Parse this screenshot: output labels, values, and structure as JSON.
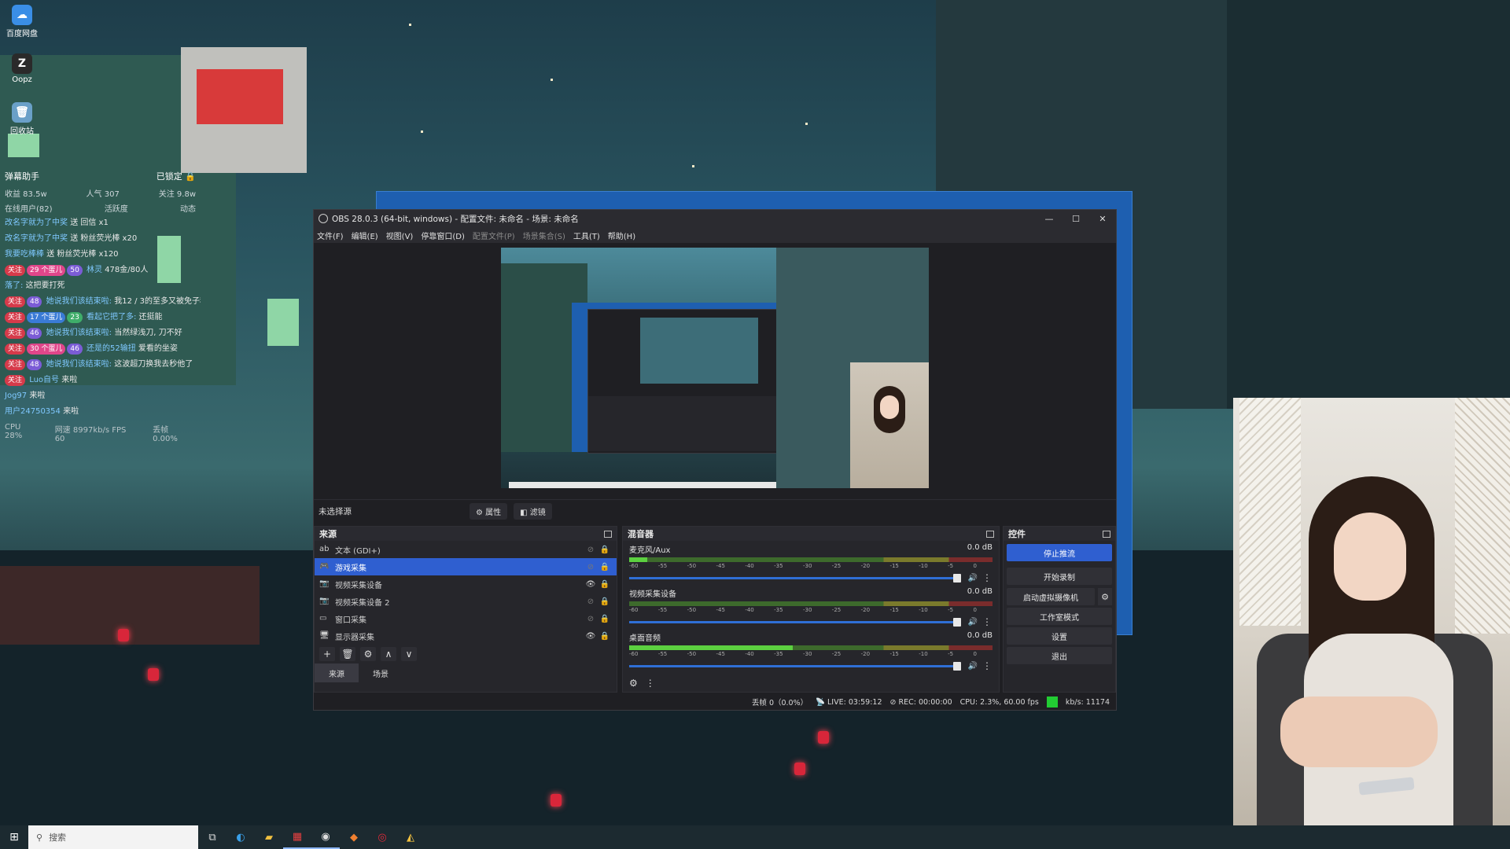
{
  "desktop": {
    "icons": [
      {
        "label": "百度网盘",
        "icon": "baidu-netdisk-icon",
        "color": "#3a8ee6"
      },
      {
        "label": "Oopz",
        "icon": "oopz-icon",
        "color": "#2a2a2a"
      },
      {
        "label": "回收站",
        "icon": "recycle-bin-icon",
        "color": "#6aa0c8"
      }
    ]
  },
  "danmaku": {
    "title": "弹幕助手",
    "locked": "已锁定",
    "stats": [
      "收益 83.5w",
      "人气 307",
      "关注 9.8w"
    ],
    "stats2": [
      "在线用户(82)",
      "活跃度",
      "动态"
    ],
    "messages": [
      {
        "badges": [],
        "user": "改名字就为了中奖",
        "text": "送 回信 x1"
      },
      {
        "badges": [],
        "user": "改名字就为了中奖",
        "text": "送 粉丝荧光棒 x20"
      },
      {
        "badges": [],
        "user": "我要吃棒棒",
        "text": "送 粉丝荧光棒 x120"
      },
      {
        "badges": [
          "关注",
          "29 个蛋儿",
          "50"
        ],
        "user": "林灵",
        "text": "478金/80人"
      },
      {
        "badges": [],
        "user": "落了:",
        "text": "这把要打死"
      },
      {
        "badges": [
          "关注",
          "48"
        ],
        "user": "她说我们该结束啦:",
        "text": "我12 / 3的至多又被免子秒了"
      },
      {
        "badges": [
          "关注",
          "17 个蛋儿",
          "23"
        ],
        "user": "看起它把了多:",
        "text": "还挺能"
      },
      {
        "badges": [
          "关注",
          "46"
        ],
        "user": "她说我们该结束啦:",
        "text": "当然绿浅刀, 刀不好"
      },
      {
        "badges": [
          "关注",
          "30 个蛋儿",
          "46"
        ],
        "user": "还是的52输扭",
        "text": "爱看的坐姿"
      },
      {
        "badges": [
          "关注",
          "48"
        ],
        "user": "她说我们该结束啦:",
        "text": "这波超刀换我去秒他了"
      },
      {
        "badges": [
          "关注"
        ],
        "user": "Luo自号",
        "text": "来啦"
      },
      {
        "badges": [],
        "user": "Jog97",
        "text": "来啦"
      },
      {
        "badges": [],
        "user": "用户24750354",
        "text": "来啦"
      }
    ],
    "footer": [
      "CPU 28%",
      "网速 8997kb/s FPS 60",
      "丢帧 0.00%"
    ]
  },
  "obs": {
    "title": "OBS 28.0.3 (64-bit, windows) - 配置文件: 未命名 - 场景: 未命名",
    "menu": [
      {
        "label": "文件(F)",
        "disabled": false
      },
      {
        "label": "编辑(E)",
        "disabled": false
      },
      {
        "label": "视图(V)",
        "disabled": false
      },
      {
        "label": "停靠窗口(D)",
        "disabled": false
      },
      {
        "label": "配置文件(P)",
        "disabled": true
      },
      {
        "label": "场景集合(S)",
        "disabled": true
      },
      {
        "label": "工具(T)",
        "disabled": false
      },
      {
        "label": "帮助(H)",
        "disabled": false
      }
    ],
    "scene_bar": {
      "label": "未选择源",
      "properties": "属性",
      "filters": "滤镜"
    },
    "sources": {
      "title": "来源",
      "items": [
        {
          "name": "文本 (GDI+)",
          "icon": "text-icon",
          "visible": false,
          "selected": false
        },
        {
          "name": "游戏采集",
          "icon": "gamepad-icon",
          "visible": false,
          "selected": true
        },
        {
          "name": "视频采集设备",
          "icon": "camera-icon",
          "visible": true,
          "selected": false
        },
        {
          "name": "视频采集设备 2",
          "icon": "camera-icon",
          "visible": false,
          "selected": false
        },
        {
          "name": "窗口采集",
          "icon": "window-icon",
          "visible": false,
          "selected": false
        },
        {
          "name": "显示器采集",
          "icon": "monitor-icon",
          "visible": true,
          "selected": false
        }
      ],
      "tabs": [
        "来源",
        "场景"
      ]
    },
    "mixer": {
      "title": "混音器",
      "ticks": [
        "-60",
        "-55",
        "-50",
        "-45",
        "-40",
        "-35",
        "-30",
        "-25",
        "-20",
        "-15",
        "-10",
        "-5",
        "0"
      ],
      "channels": [
        {
          "name": "麦克风/Aux",
          "db": "0.0 dB",
          "level": 0.05
        },
        {
          "name": "视频采集设备",
          "db": "0.0 dB",
          "level": 0.0
        },
        {
          "name": "桌面音频",
          "db": "0.0 dB",
          "level": 0.45
        }
      ]
    },
    "controls": {
      "title": "控件",
      "buttons": [
        "停止推流",
        "开始录制",
        "启动虚拟摄像机",
        "工作室模式",
        "设置",
        "退出"
      ]
    },
    "status": {
      "dropped": "丢帧 0（0.0%）",
      "live": "LIVE: 03:59:12",
      "rec": "REC: 00:00:00",
      "cpu": "CPU: 2.3%, 60.00 fps",
      "bitrate": "kb/s: 11174",
      "bitrate_color": "#22cc33"
    }
  },
  "taskbar": {
    "search_placeholder": "搜索",
    "apps": [
      "task-view-icon",
      "edge-icon",
      "file-explorer-icon",
      "app-red-icon",
      "obs-icon",
      "app-orange-icon",
      "netease-music-icon",
      "app-yellow-icon"
    ]
  }
}
